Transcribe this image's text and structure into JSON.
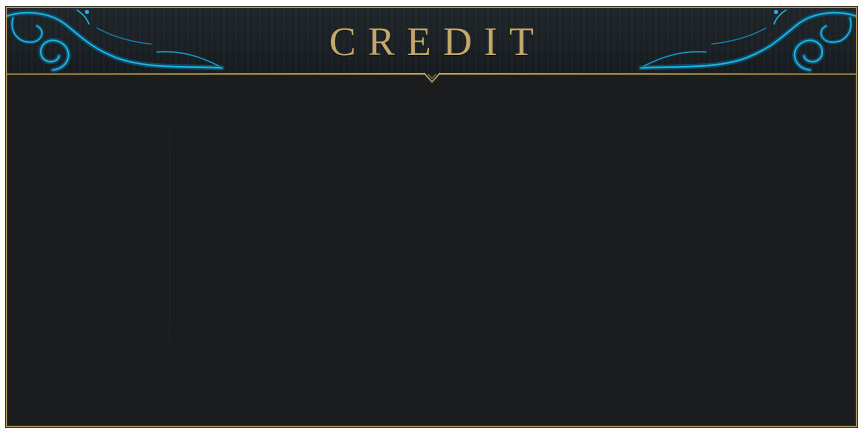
{
  "window": {
    "title": "CREDIT"
  },
  "colors": {
    "accent_gold": "#c5a86b",
    "ornament_blue": "#1aa6d6",
    "panel_bg": "#1b1c1e",
    "header_bg": "#1c2226"
  },
  "icons": {
    "left_ornament": "filigree-ornament-icon",
    "right_ornament": "filigree-ornament-icon",
    "center_notch": "chevron-down-icon"
  }
}
